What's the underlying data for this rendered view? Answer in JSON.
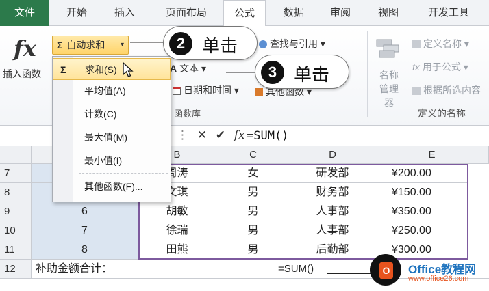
{
  "tabs": [
    "文件",
    "开始",
    "插入",
    "页面布局",
    "公式",
    "数据",
    "审阅",
    "视图",
    "开发工具"
  ],
  "ribbon": {
    "insert_function": "插入函数",
    "fx_symbol": "fx",
    "autosum": "自动求和",
    "lookup": "查找与引用",
    "text": "文本",
    "datetime": "日期和时间",
    "other_functions": "其他函数",
    "function_library_group": "函数库",
    "define_name": "定义名称",
    "use_in_formula": "用于公式",
    "create_from_selection": "根据所选内容",
    "name_manager_line1": "名称",
    "name_manager_line2": "管理器",
    "defined_names_group": "定义的名称"
  },
  "formula_bar": {
    "formula": "=SUM()"
  },
  "dropdown": {
    "items": [
      "求和(S)",
      "平均值(A)",
      "计数(C)",
      "最大值(M)",
      "最小值(I)",
      "其他函数(F)..."
    ]
  },
  "callouts": [
    {
      "num": "2",
      "text": "单击"
    },
    {
      "num": "3",
      "text": "单击"
    }
  ],
  "columns": [
    "B",
    "C",
    "D",
    "E"
  ],
  "rows": [
    {
      "num": "7",
      "a": "",
      "b": "周涛",
      "c": "女",
      "d": "研发部",
      "e": "¥200.00"
    },
    {
      "num": "8",
      "a": "",
      "b": "文琪",
      "c": "男",
      "d": "财务部",
      "e": "¥150.00"
    },
    {
      "num": "9",
      "a": "6",
      "b": "胡敏",
      "c": "男",
      "d": "人事部",
      "e": "¥350.00"
    },
    {
      "num": "10",
      "a": "7",
      "b": "徐瑞",
      "c": "男",
      "d": "人事部",
      "e": "¥250.00"
    },
    {
      "num": "11",
      "a": "8",
      "b": "田熊",
      "c": "男",
      "d": "后勤部",
      "e": "¥300.00"
    }
  ],
  "row12": {
    "num": "12",
    "label": "补助金额合计：",
    "formula": "=SUM()"
  },
  "watermark": {
    "title": "Office教程网",
    "url": "www.office26.com",
    "logo": "O"
  }
}
